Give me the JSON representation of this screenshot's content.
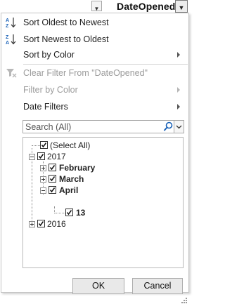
{
  "header": {
    "column_title": "DateOpened"
  },
  "menu": {
    "sort_oldest": "Sort Oldest to Newest",
    "sort_newest": "Sort Newest to Oldest",
    "sort_by_color": "Sort by Color",
    "clear_filter": "Clear Filter From \"DateOpened\"",
    "filter_by_color": "Filter by Color",
    "date_filters": "Date Filters"
  },
  "search": {
    "placeholder": "Search (All)"
  },
  "tree": {
    "select_all": "(Select All)",
    "year_2017": "2017",
    "february": "February",
    "march": "March",
    "april": "April",
    "day_13": "13",
    "year_2016": "2016"
  },
  "buttons": {
    "ok": "OK",
    "cancel": "Cancel"
  },
  "colors": {
    "disabled_text": "#9b9b9b",
    "button_face": "#e9e9e9"
  }
}
